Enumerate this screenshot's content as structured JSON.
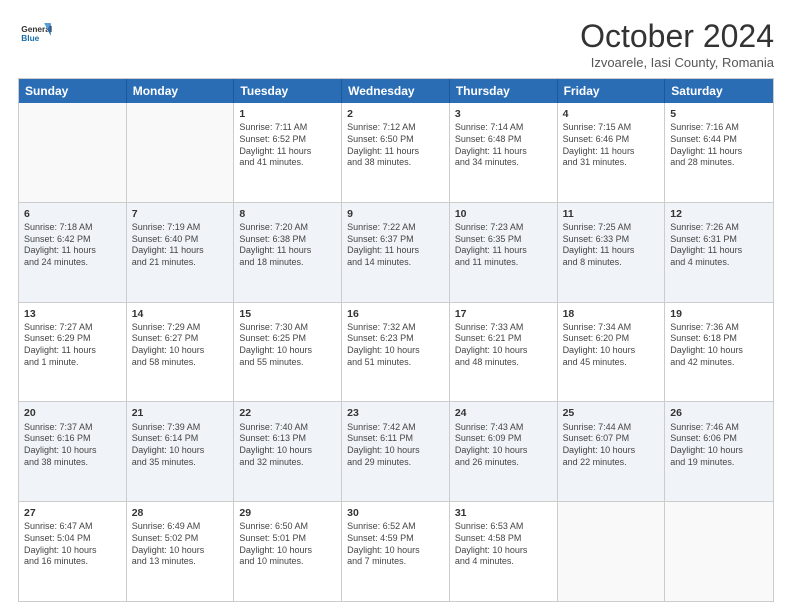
{
  "header": {
    "logo_general": "General",
    "logo_blue": "Blue",
    "month_title": "October 2024",
    "subtitle": "Izvoarele, Iasi County, Romania"
  },
  "days_of_week": [
    "Sunday",
    "Monday",
    "Tuesday",
    "Wednesday",
    "Thursday",
    "Friday",
    "Saturday"
  ],
  "rows": [
    {
      "alt": false,
      "cells": [
        {
          "day": "",
          "empty": true,
          "lines": []
        },
        {
          "day": "",
          "empty": true,
          "lines": []
        },
        {
          "day": "1",
          "empty": false,
          "lines": [
            "Sunrise: 7:11 AM",
            "Sunset: 6:52 PM",
            "Daylight: 11 hours",
            "and 41 minutes."
          ]
        },
        {
          "day": "2",
          "empty": false,
          "lines": [
            "Sunrise: 7:12 AM",
            "Sunset: 6:50 PM",
            "Daylight: 11 hours",
            "and 38 minutes."
          ]
        },
        {
          "day": "3",
          "empty": false,
          "lines": [
            "Sunrise: 7:14 AM",
            "Sunset: 6:48 PM",
            "Daylight: 11 hours",
            "and 34 minutes."
          ]
        },
        {
          "day": "4",
          "empty": false,
          "lines": [
            "Sunrise: 7:15 AM",
            "Sunset: 6:46 PM",
            "Daylight: 11 hours",
            "and 31 minutes."
          ]
        },
        {
          "day": "5",
          "empty": false,
          "lines": [
            "Sunrise: 7:16 AM",
            "Sunset: 6:44 PM",
            "Daylight: 11 hours",
            "and 28 minutes."
          ]
        }
      ]
    },
    {
      "alt": true,
      "cells": [
        {
          "day": "6",
          "empty": false,
          "lines": [
            "Sunrise: 7:18 AM",
            "Sunset: 6:42 PM",
            "Daylight: 11 hours",
            "and 24 minutes."
          ]
        },
        {
          "day": "7",
          "empty": false,
          "lines": [
            "Sunrise: 7:19 AM",
            "Sunset: 6:40 PM",
            "Daylight: 11 hours",
            "and 21 minutes."
          ]
        },
        {
          "day": "8",
          "empty": false,
          "lines": [
            "Sunrise: 7:20 AM",
            "Sunset: 6:38 PM",
            "Daylight: 11 hours",
            "and 18 minutes."
          ]
        },
        {
          "day": "9",
          "empty": false,
          "lines": [
            "Sunrise: 7:22 AM",
            "Sunset: 6:37 PM",
            "Daylight: 11 hours",
            "and 14 minutes."
          ]
        },
        {
          "day": "10",
          "empty": false,
          "lines": [
            "Sunrise: 7:23 AM",
            "Sunset: 6:35 PM",
            "Daylight: 11 hours",
            "and 11 minutes."
          ]
        },
        {
          "day": "11",
          "empty": false,
          "lines": [
            "Sunrise: 7:25 AM",
            "Sunset: 6:33 PM",
            "Daylight: 11 hours",
            "and 8 minutes."
          ]
        },
        {
          "day": "12",
          "empty": false,
          "lines": [
            "Sunrise: 7:26 AM",
            "Sunset: 6:31 PM",
            "Daylight: 11 hours",
            "and 4 minutes."
          ]
        }
      ]
    },
    {
      "alt": false,
      "cells": [
        {
          "day": "13",
          "empty": false,
          "lines": [
            "Sunrise: 7:27 AM",
            "Sunset: 6:29 PM",
            "Daylight: 11 hours",
            "and 1 minute."
          ]
        },
        {
          "day": "14",
          "empty": false,
          "lines": [
            "Sunrise: 7:29 AM",
            "Sunset: 6:27 PM",
            "Daylight: 10 hours",
            "and 58 minutes."
          ]
        },
        {
          "day": "15",
          "empty": false,
          "lines": [
            "Sunrise: 7:30 AM",
            "Sunset: 6:25 PM",
            "Daylight: 10 hours",
            "and 55 minutes."
          ]
        },
        {
          "day": "16",
          "empty": false,
          "lines": [
            "Sunrise: 7:32 AM",
            "Sunset: 6:23 PM",
            "Daylight: 10 hours",
            "and 51 minutes."
          ]
        },
        {
          "day": "17",
          "empty": false,
          "lines": [
            "Sunrise: 7:33 AM",
            "Sunset: 6:21 PM",
            "Daylight: 10 hours",
            "and 48 minutes."
          ]
        },
        {
          "day": "18",
          "empty": false,
          "lines": [
            "Sunrise: 7:34 AM",
            "Sunset: 6:20 PM",
            "Daylight: 10 hours",
            "and 45 minutes."
          ]
        },
        {
          "day": "19",
          "empty": false,
          "lines": [
            "Sunrise: 7:36 AM",
            "Sunset: 6:18 PM",
            "Daylight: 10 hours",
            "and 42 minutes."
          ]
        }
      ]
    },
    {
      "alt": true,
      "cells": [
        {
          "day": "20",
          "empty": false,
          "lines": [
            "Sunrise: 7:37 AM",
            "Sunset: 6:16 PM",
            "Daylight: 10 hours",
            "and 38 minutes."
          ]
        },
        {
          "day": "21",
          "empty": false,
          "lines": [
            "Sunrise: 7:39 AM",
            "Sunset: 6:14 PM",
            "Daylight: 10 hours",
            "and 35 minutes."
          ]
        },
        {
          "day": "22",
          "empty": false,
          "lines": [
            "Sunrise: 7:40 AM",
            "Sunset: 6:13 PM",
            "Daylight: 10 hours",
            "and 32 minutes."
          ]
        },
        {
          "day": "23",
          "empty": false,
          "lines": [
            "Sunrise: 7:42 AM",
            "Sunset: 6:11 PM",
            "Daylight: 10 hours",
            "and 29 minutes."
          ]
        },
        {
          "day": "24",
          "empty": false,
          "lines": [
            "Sunrise: 7:43 AM",
            "Sunset: 6:09 PM",
            "Daylight: 10 hours",
            "and 26 minutes."
          ]
        },
        {
          "day": "25",
          "empty": false,
          "lines": [
            "Sunrise: 7:44 AM",
            "Sunset: 6:07 PM",
            "Daylight: 10 hours",
            "and 22 minutes."
          ]
        },
        {
          "day": "26",
          "empty": false,
          "lines": [
            "Sunrise: 7:46 AM",
            "Sunset: 6:06 PM",
            "Daylight: 10 hours",
            "and 19 minutes."
          ]
        }
      ]
    },
    {
      "alt": false,
      "cells": [
        {
          "day": "27",
          "empty": false,
          "lines": [
            "Sunrise: 6:47 AM",
            "Sunset: 5:04 PM",
            "Daylight: 10 hours",
            "and 16 minutes."
          ]
        },
        {
          "day": "28",
          "empty": false,
          "lines": [
            "Sunrise: 6:49 AM",
            "Sunset: 5:02 PM",
            "Daylight: 10 hours",
            "and 13 minutes."
          ]
        },
        {
          "day": "29",
          "empty": false,
          "lines": [
            "Sunrise: 6:50 AM",
            "Sunset: 5:01 PM",
            "Daylight: 10 hours",
            "and 10 minutes."
          ]
        },
        {
          "day": "30",
          "empty": false,
          "lines": [
            "Sunrise: 6:52 AM",
            "Sunset: 4:59 PM",
            "Daylight: 10 hours",
            "and 7 minutes."
          ]
        },
        {
          "day": "31",
          "empty": false,
          "lines": [
            "Sunrise: 6:53 AM",
            "Sunset: 4:58 PM",
            "Daylight: 10 hours",
            "and 4 minutes."
          ]
        },
        {
          "day": "",
          "empty": true,
          "lines": []
        },
        {
          "day": "",
          "empty": true,
          "lines": []
        }
      ]
    }
  ]
}
